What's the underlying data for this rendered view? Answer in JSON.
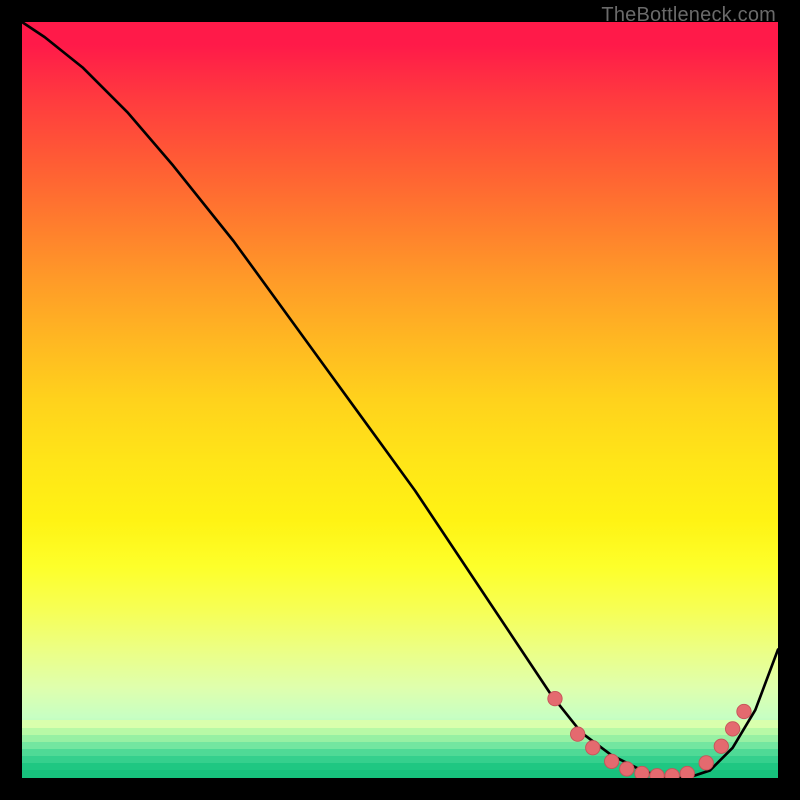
{
  "watermark": "TheBottleneck.com",
  "colors": {
    "curve": "#000000",
    "dot": "#e46a6f",
    "dot_stroke": "#c65359"
  },
  "chart_data": {
    "type": "line",
    "title": "",
    "xlabel": "",
    "ylabel": "",
    "xlim": [
      0,
      100
    ],
    "ylim": [
      0,
      100
    ],
    "series": [
      {
        "name": "bottleneck-curve",
        "x": [
          0,
          3,
          8,
          14,
          20,
          28,
          36,
          44,
          52,
          58,
          62,
          66,
          70,
          74,
          78,
          82,
          85,
          88,
          91,
          94,
          97,
          100
        ],
        "y": [
          100,
          98,
          94,
          88,
          81,
          71,
          60,
          49,
          38,
          29,
          23,
          17,
          11,
          6,
          3,
          1,
          0,
          0,
          1,
          4,
          9,
          17
        ]
      }
    ],
    "markers": {
      "name": "highlighted-points",
      "x": [
        70.5,
        73.5,
        75.5,
        78,
        80,
        82,
        84,
        86,
        88,
        90.5,
        92.5,
        94,
        95.5
      ],
      "y": [
        10.5,
        5.8,
        4.0,
        2.2,
        1.2,
        0.6,
        0.3,
        0.3,
        0.6,
        2.0,
        4.2,
        6.5,
        8.8
      ]
    },
    "bottom_bands": [
      {
        "color": "#d9ffad",
        "h": 8
      },
      {
        "color": "#b8f9a6",
        "h": 7
      },
      {
        "color": "#97f0a3",
        "h": 7
      },
      {
        "color": "#73e6a0",
        "h": 7
      },
      {
        "color": "#4fda96",
        "h": 7
      },
      {
        "color": "#35d08d",
        "h": 7
      },
      {
        "color": "#1fc782",
        "h": 7
      },
      {
        "color": "#17c07c",
        "h": 8
      }
    ]
  }
}
